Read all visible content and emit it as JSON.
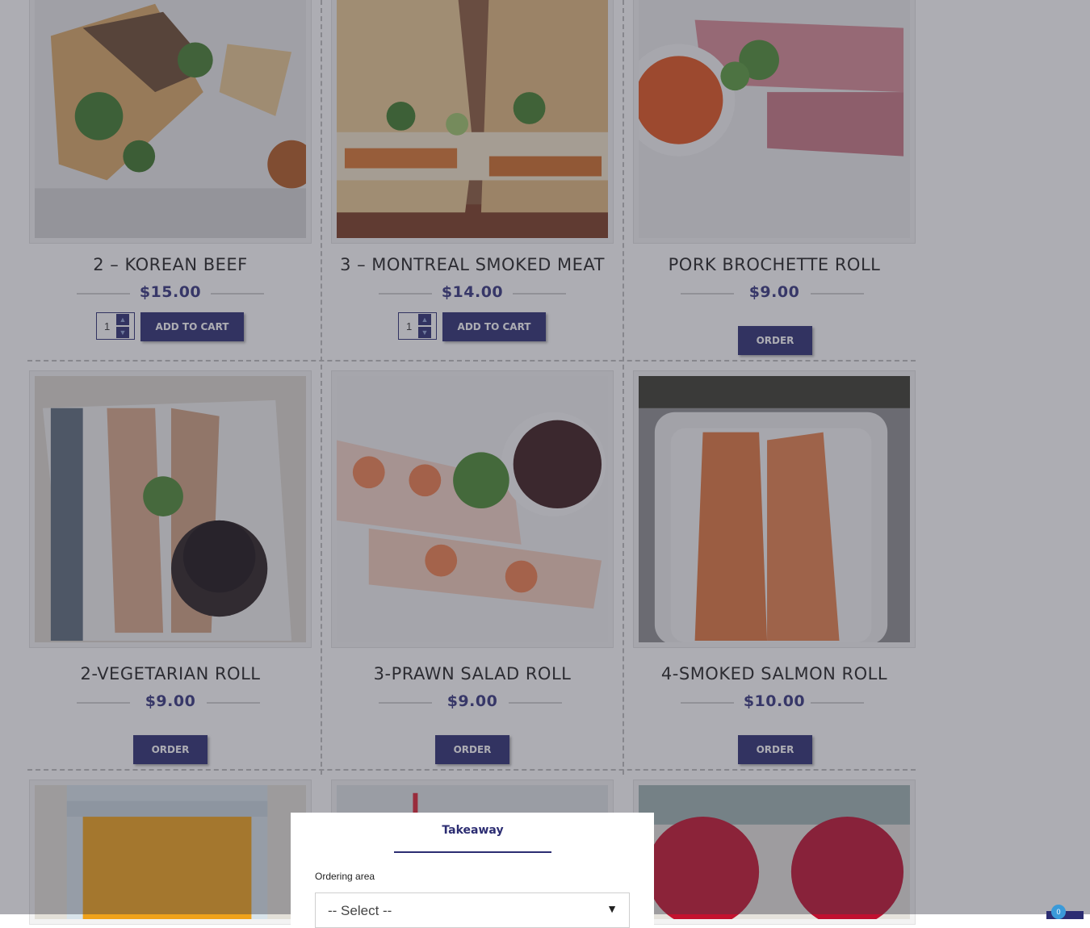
{
  "products": [
    {
      "title": "2 – KOREAN BEEF",
      "price": "$15.00",
      "qty": "1",
      "action": "ADD TO CART"
    },
    {
      "title": "3 – MONTREAL SMOKED MEAT",
      "price": "$14.00",
      "qty": "1",
      "action": "ADD TO CART"
    },
    {
      "title": "PORK BROCHETTE ROLL",
      "price": "$9.00",
      "action": "ORDER"
    },
    {
      "title": "2-VEGETARIAN ROLL",
      "price": "$9.00",
      "action": "ORDER"
    },
    {
      "title": "3-PRAWN SALAD ROLL",
      "price": "$9.00",
      "action": "ORDER"
    },
    {
      "title": "4-SMOKED SALMON ROLL",
      "price": "$10.00",
      "action": "ORDER"
    }
  ],
  "order_modal": {
    "tab_label": "Takeaway",
    "area_label": "Ordering area",
    "select_value": "-- Select --"
  },
  "cart": {
    "count": "0"
  },
  "colors": {
    "brand": "#2c2d72",
    "badge": "#3a9ad9"
  }
}
